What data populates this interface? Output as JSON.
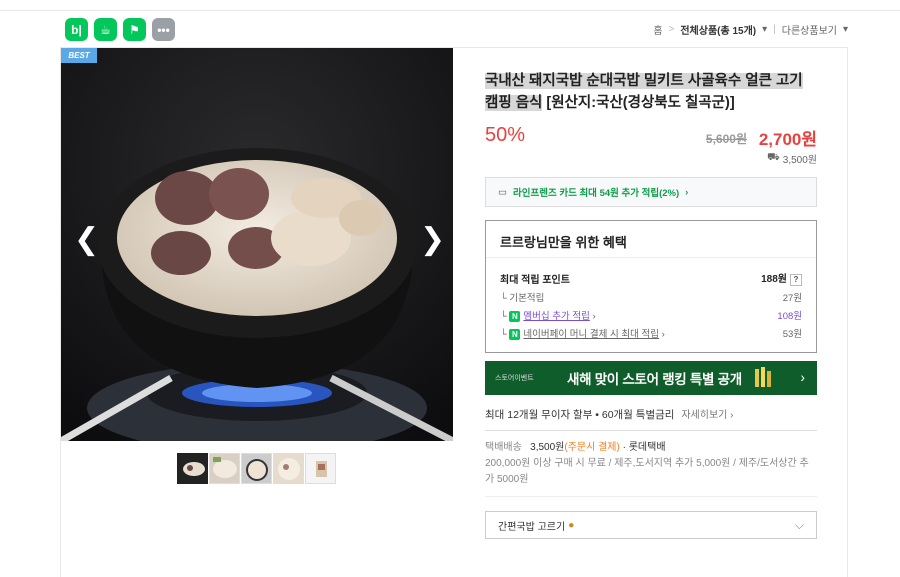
{
  "header": {
    "icons": [
      {
        "name": "blog-icon",
        "glyph": "b|"
      },
      {
        "name": "cafe-icon",
        "glyph": "☕"
      },
      {
        "name": "bookmark-icon",
        "glyph": "⚑"
      },
      {
        "name": "more-icon",
        "glyph": "•••"
      }
    ],
    "breadcrumb": {
      "home": "홈",
      "all_products": "전체상품(총 15개)",
      "other_products": "다른상품보기"
    }
  },
  "gallery": {
    "badge": "BEST",
    "thumb_count": 5
  },
  "product": {
    "title_highlight": "국내산 돼지국밥 순대국밥 밀키트 사골육수 얼큰 고기 캠핑 음식",
    "title_suffix": "[원산지:국산(경상북도 칠곡군)]",
    "discount": "50%",
    "original_price": "5,600원",
    "sale_price": "2,700원",
    "shipping_fee": "3,500원"
  },
  "card_benefit": "라인프렌즈 카드 최대 54원 추가 적립(2%)",
  "benefits": {
    "title": "르르랑님만을 위한 혜택",
    "max_points_label": "최대 적립 포인트",
    "max_points_value": "188원",
    "basic_label": "기본적립",
    "basic_value": "27원",
    "membership_label": "멤버십 추가 적립",
    "membership_value": "108원",
    "npay_label": "네이버페이 머니 결제 시 최대 적립",
    "npay_value": "53원"
  },
  "banner": {
    "small": "스토어이벤트",
    "text": "새해 맞이 스토어 랭킹 특별 공개"
  },
  "installment": {
    "text": "최대 12개월 무이자 할부 • 60개월 특별금리",
    "link": "자세히보기"
  },
  "delivery": {
    "method": "택배배송",
    "fee": "3,500원",
    "note": "(주문시 결제)",
    "carrier": "롯데택배",
    "policy": "200,000원 이상 구매 시 무료 / 제주,도서지역 추가 5,000원 / 제주/도서상간 추가 5000원"
  },
  "option": {
    "placeholder": "간편국밥 고르기"
  },
  "colors": {
    "accent_red": "#e8423f",
    "naver_green": "#03c75a",
    "banner_green": "#0f5d2a"
  }
}
